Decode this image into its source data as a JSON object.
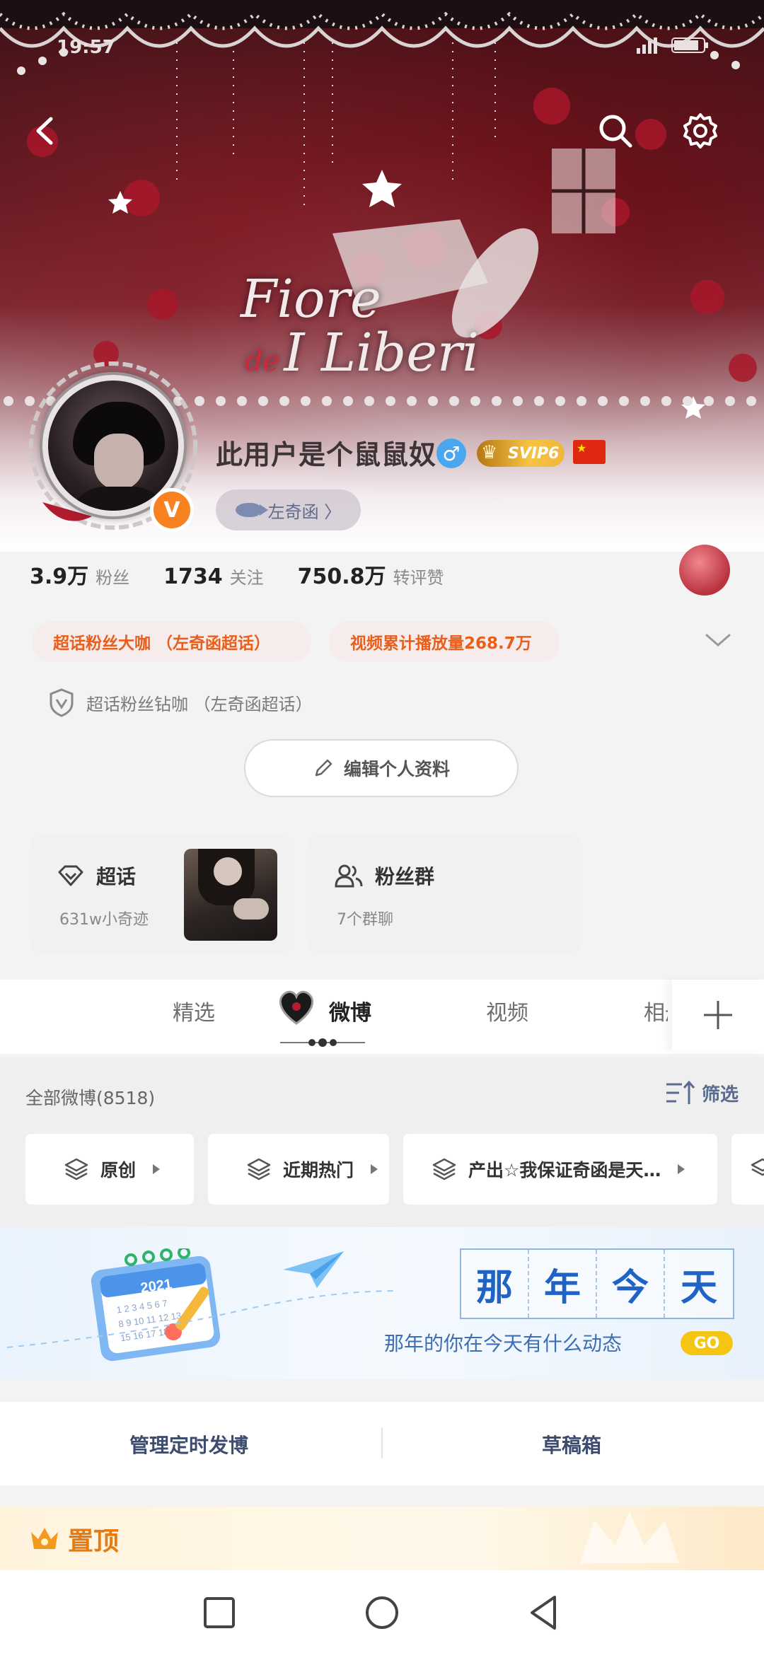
{
  "status_bar": {
    "time": "19:57"
  },
  "banner": {
    "title_part1": "Fiore",
    "title_de": "de",
    "title_part2": "I Liberi"
  },
  "profile": {
    "username": "此用户是个鼠鼠奴",
    "gender_symbol": "♂",
    "vip_label": "SVIP6",
    "verified_badge": "V",
    "group_chip_label": "左奇函 〉",
    "stats": [
      {
        "value": "3.9万",
        "label": "粉丝"
      },
      {
        "value": "1734",
        "label": "关注"
      },
      {
        "value": "750.8万",
        "label": "转评赞"
      }
    ],
    "tags": [
      "超话粉丝大咖 （左奇函超话）",
      "视频累计播放量268.7万"
    ],
    "diamond_label": "超话粉丝钻咖 （左奇函超话）",
    "edit_button": "编辑个人资料"
  },
  "cards": {
    "super_topic": {
      "title": "超话",
      "subtitle": "631w小奇迹"
    },
    "fan_group": {
      "title": "粉丝群",
      "subtitle": "7个群聊"
    }
  },
  "tabs": [
    "精选",
    "微博",
    "视频",
    "相册"
  ],
  "feed": {
    "count_label": "全部微博(8518)",
    "filter_label": "筛选",
    "chips": [
      "原创",
      "近期热门",
      "产出☆我保证奇函是天…"
    ]
  },
  "memory": {
    "grid_chars": [
      "那",
      "年",
      "今",
      "天"
    ],
    "subtitle": "那年的你在今天有什么动态",
    "go_label": "GO",
    "calendar_year": "2021"
  },
  "actions": {
    "schedule": "管理定时发博",
    "drafts": "草稿箱"
  },
  "pinned": {
    "label": "置顶"
  },
  "colors": {
    "accent_orange": "#e85e1a",
    "link_blue": "#586c8f",
    "memory_blue": "#1f63c6",
    "vip_gold": "#f6c445"
  }
}
